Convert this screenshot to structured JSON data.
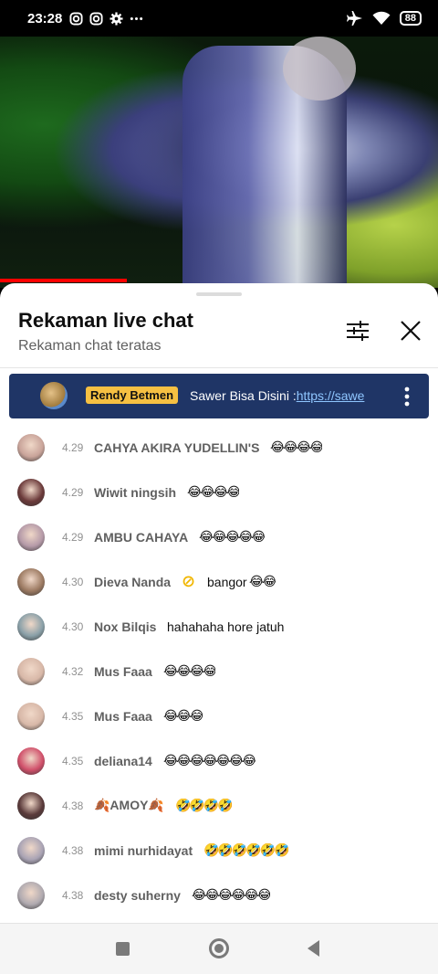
{
  "status_bar": {
    "time": "23:28",
    "battery": "88",
    "left_icons": [
      "instagram-icon",
      "instagram-icon",
      "settings-gear-icon",
      "more-dots-icon"
    ],
    "right_icons": [
      "airplane-mode-icon",
      "wifi-icon",
      "battery-icon"
    ]
  },
  "video": {
    "progress_fraction": 0.29,
    "progress_color": "#ff0000"
  },
  "sheet": {
    "title": "Rekaman live chat",
    "subtitle": "Rekaman chat teratas"
  },
  "pinned": {
    "author": "Rendy Betmen",
    "text": "Sawer Bisa Disini :",
    "link": "https://sawe"
  },
  "messages": [
    {
      "time": "4.29",
      "author": "CAHYA AKIRA YUDELLIN'S",
      "text": "",
      "emoji": "😂😂😂😂",
      "avatar_color": "#c9a49a"
    },
    {
      "time": "4.29",
      "author": "Wiwit ningsih",
      "text": "",
      "emoji": "😂😂😂😂",
      "avatar_color": "#6b3a3a"
    },
    {
      "time": "4.29",
      "author": "AMBU CAHAYA",
      "text": "",
      "emoji": "😂😂😂😂😂",
      "avatar_color": "#b59aa8"
    },
    {
      "time": "4.30",
      "author": "Dieva Nanda",
      "badge": "⊘",
      "text": "bangor",
      "emoji": "😂😂",
      "avatar_color": "#9c7a62"
    },
    {
      "time": "4.30",
      "author": "Nox Bilqis",
      "text": "hahahaha hore jatuh",
      "emoji": "",
      "avatar_color": "#8aa0a8"
    },
    {
      "time": "4.32",
      "author": "Mus Faaa",
      "text": "",
      "emoji": "😂😂😂😂",
      "avatar_color": "#d8b8a8"
    },
    {
      "time": "4.35",
      "author": "Mus Faaa",
      "text": "",
      "emoji": "😂😂😂",
      "avatar_color": "#d8b8a8"
    },
    {
      "time": "4.35",
      "author": "deliana14",
      "text": "",
      "emoji": "😂😂😂😂😂😂😂",
      "avatar_color": "#d0506a"
    },
    {
      "time": "4.38",
      "author": "🍂AMOY🍂",
      "text": "",
      "emoji": "🤣🤣🤣🤣",
      "avatar_color": "#5a3a3a"
    },
    {
      "time": "4.38",
      "author": "mimi nurhidayat",
      "text": "",
      "emoji": "🤣🤣🤣🤣🤣🤣",
      "avatar_color": "#a9a3b4"
    },
    {
      "time": "4.38",
      "author": "desty suherny",
      "text": "",
      "emoji": "😂😂😂😂😂😂",
      "avatar_color": "#b0aab0"
    }
  ],
  "navbar": {
    "buttons": [
      "recents-square-icon",
      "home-circle-icon",
      "back-triangle-icon"
    ]
  }
}
